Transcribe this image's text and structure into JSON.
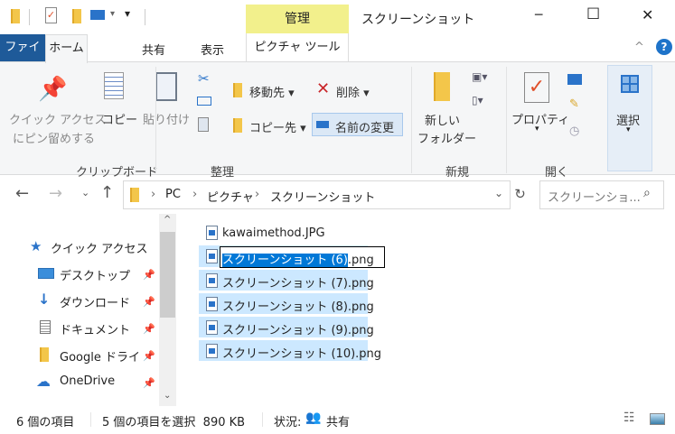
{
  "titlebar": {
    "title": "スクリーンショット",
    "context_tab": "管理",
    "qa_dropdown": "▾",
    "minimize": "─",
    "maximize": "☐",
    "close": "✕"
  },
  "tabs": [
    {
      "label": "ファイル"
    },
    {
      "label": "ホーム"
    },
    {
      "label": "共有"
    },
    {
      "label": "表示"
    },
    {
      "label": "ピクチャ ツール"
    }
  ],
  "ribbon_controls": {
    "collapse": "^",
    "help": "?"
  },
  "ribbon": {
    "clipboard": {
      "label": "クリップボード",
      "pin_line1": "クイック アクセス",
      "pin_line2": "にピン留めする",
      "copy": "コピー",
      "paste": "貼り付け"
    },
    "organize": {
      "label": "整理",
      "move_to": "移動先",
      "delete": "削除",
      "copy_to": "コピー先",
      "rename": "名前の変更"
    },
    "new": {
      "label": "新規",
      "new_folder_line1": "新しい",
      "new_folder_line2": "フォルダー"
    },
    "open": {
      "label": "開く",
      "properties": "プロパティ"
    },
    "select": {
      "label": "選択"
    }
  },
  "address": {
    "path": [
      "PC",
      "ピクチャ",
      "スクリーンショット"
    ],
    "search_placeholder": "スクリーンショ..."
  },
  "nav": {
    "items": [
      {
        "label": "クイック アクセス"
      },
      {
        "label": "デスクトップ"
      },
      {
        "label": "ダウンロード"
      },
      {
        "label": "ドキュメント"
      },
      {
        "label": "Google ドライ"
      },
      {
        "label": "OneDrive"
      }
    ]
  },
  "files": [
    {
      "name": "kawaimethod.JPG",
      "selected": false
    },
    {
      "name": "スクリーンショット (6).png",
      "selected": true,
      "renaming": true,
      "rename_selected": "スクリーンショット (6)",
      "rename_rest": ".png"
    },
    {
      "name": "スクリーンショット (7).png",
      "selected": true
    },
    {
      "name": "スクリーンショット (8).png",
      "selected": true
    },
    {
      "name": "スクリーンショット (9).png",
      "selected": true
    },
    {
      "name": "スクリーンショット (10).png",
      "selected": true
    }
  ],
  "status": {
    "count": "6 個の項目",
    "selection": "5 個の項目を選択  890 KB",
    "state_label": "状況:",
    "state_value": "共有"
  },
  "colors": {
    "file_tab": "#1e5a99",
    "context_tab": "#f2f08c",
    "selection": "#cce8ff",
    "rename_highlight": "#0078d7"
  }
}
